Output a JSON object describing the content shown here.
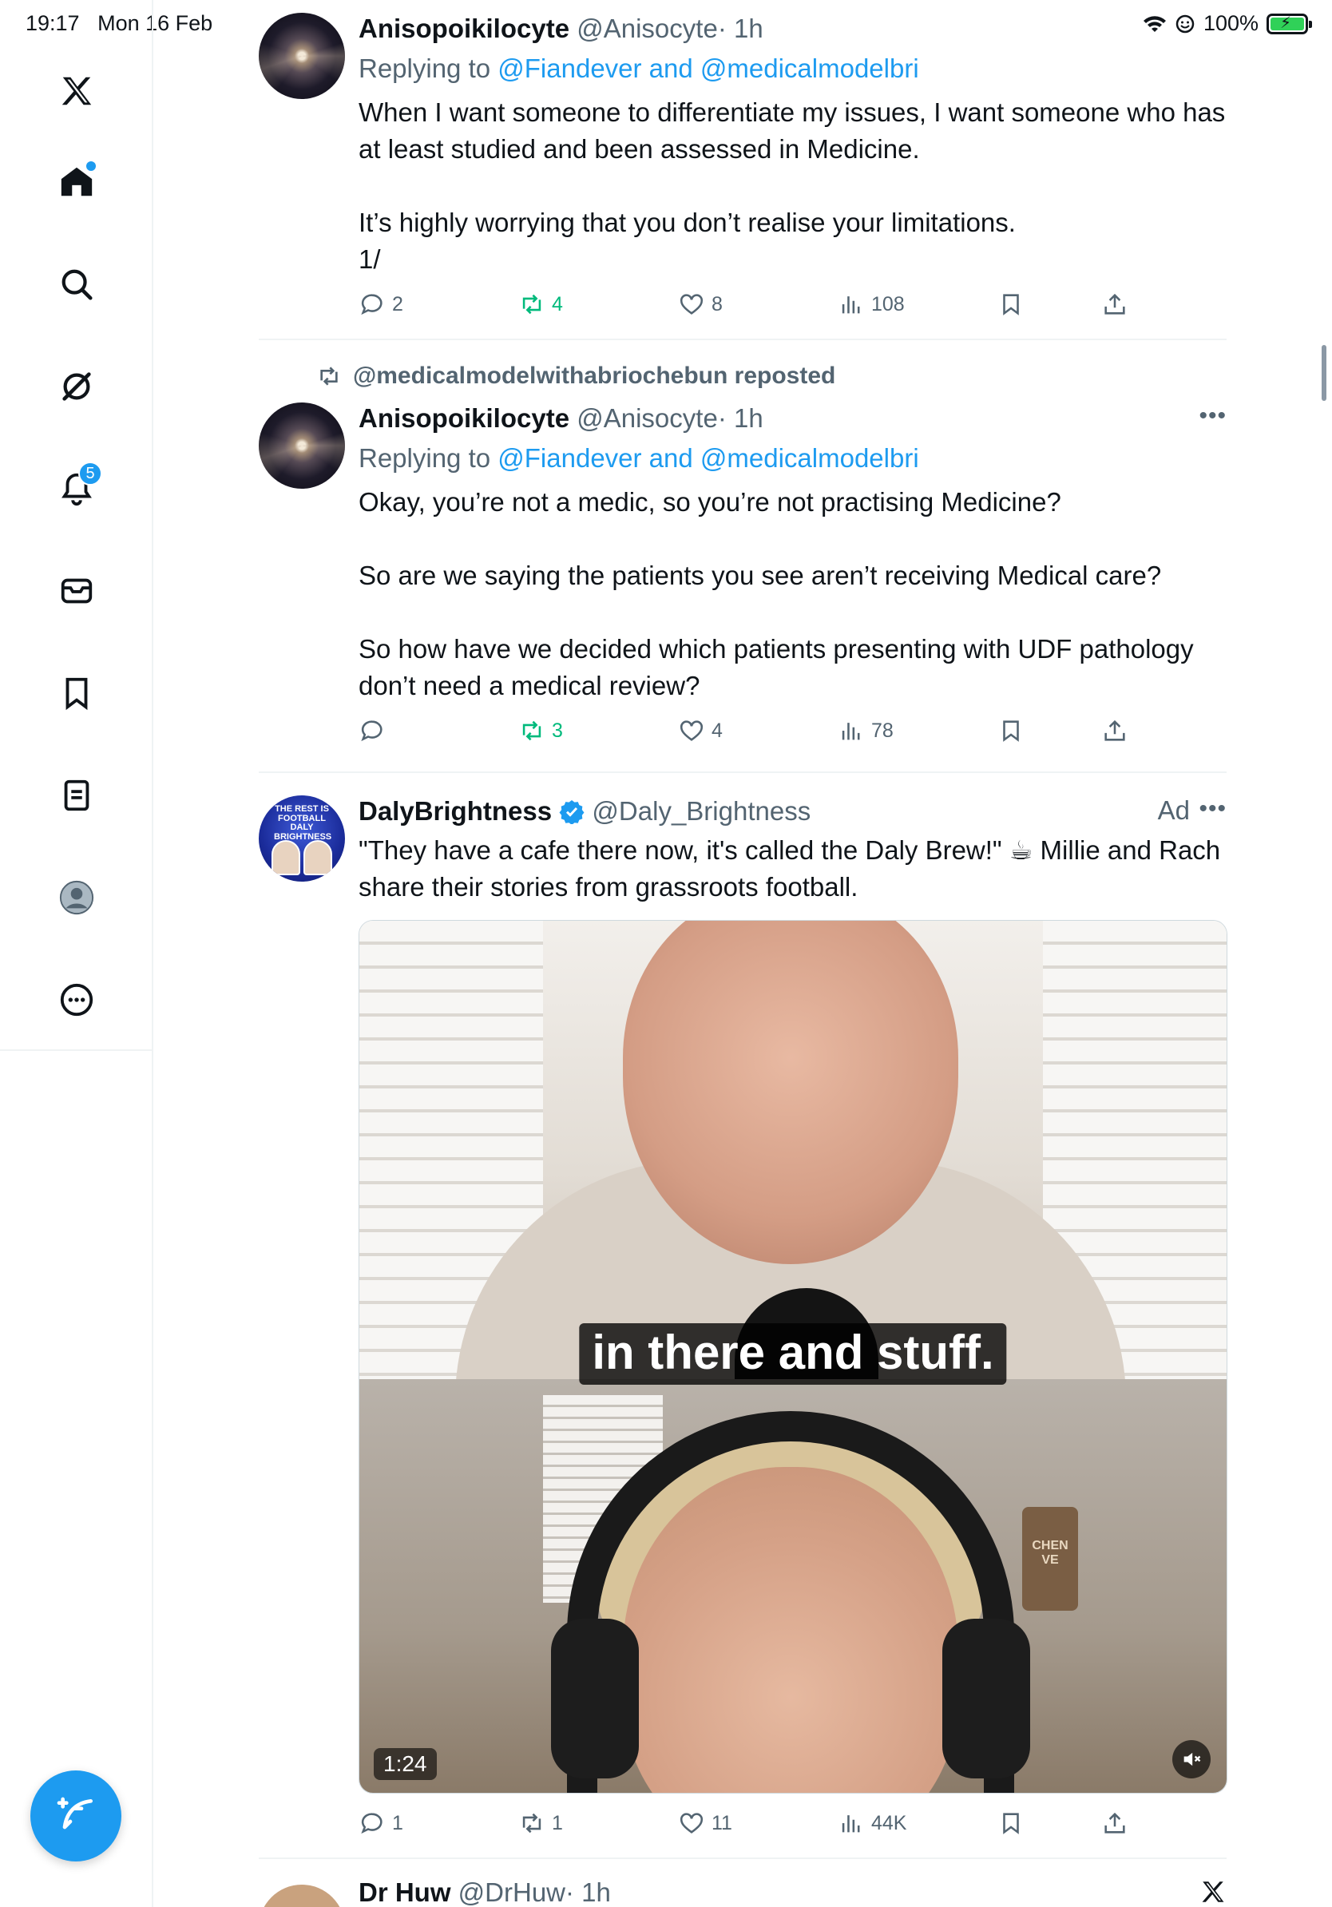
{
  "status_bar": {
    "time": "19:17",
    "date": "Mon 16 Feb",
    "battery": "100%"
  },
  "sidebar": {
    "items": [
      {
        "name": "x-logo"
      },
      {
        "name": "home"
      },
      {
        "name": "search"
      },
      {
        "name": "grok"
      },
      {
        "name": "notifications",
        "badge": "5"
      },
      {
        "name": "messages"
      },
      {
        "name": "bookmarks"
      },
      {
        "name": "lists"
      },
      {
        "name": "profile"
      },
      {
        "name": "more"
      }
    ],
    "compose_icon": "compose-icon"
  },
  "tweets": [
    {
      "name": "Anisopoikilocyte",
      "handle": "@Anisocyte",
      "time": "· 1h",
      "replying_prefix": "Replying to ",
      "replying_mentions": "@Fiandever and @medicalmodelbri",
      "text": "When I want someone to differentiate my issues, I want someone who has at least studied and been assessed in Medicine.\n\nIt’s highly worrying that you don’t realise your limitations.\n1/",
      "replies": "2",
      "reposts": "4",
      "likes": "8",
      "views": "108"
    },
    {
      "reposted_by": "@medicalmodelwithabriochebun reposted",
      "name": "Anisopoikilocyte",
      "handle": "@Anisocyte",
      "time": "· 1h",
      "replying_prefix": "Replying to ",
      "replying_mentions": "@Fiandever and @medicalmodelbri",
      "text": "Okay, you’re not a medic, so you’re not practising Medicine?\n\nSo are we saying the patients you see aren’t receiving Medical care?\n\nSo how have we decided which patients presenting with UDF pathology don’t need a medical review?",
      "replies": "",
      "reposts": "3",
      "likes": "4",
      "views": "78"
    },
    {
      "name": "DalyBrightness",
      "handle": "@Daly_Brightness",
      "ad_label": "Ad",
      "avatar_text": "THE REST IS FOOTBALL DALY BRIGHTNESS",
      "text": "\"They have a cafe there now, it's called the Daly Brew!\" ☕ Millie and Rach share their stories from grassroots football.",
      "video_caption": "in there and stuff.",
      "video_duration": "1:24",
      "sign_text": "CHEN VE",
      "replies": "1",
      "reposts": "1",
      "likes": "11",
      "views": "44K"
    },
    {
      "name": "Dr Huw",
      "handle": "@DrHuw",
      "time": "· 1h"
    }
  ],
  "colors": {
    "accent": "#1d9bf0",
    "repost_green": "#00ba7c",
    "muted": "#536471"
  }
}
